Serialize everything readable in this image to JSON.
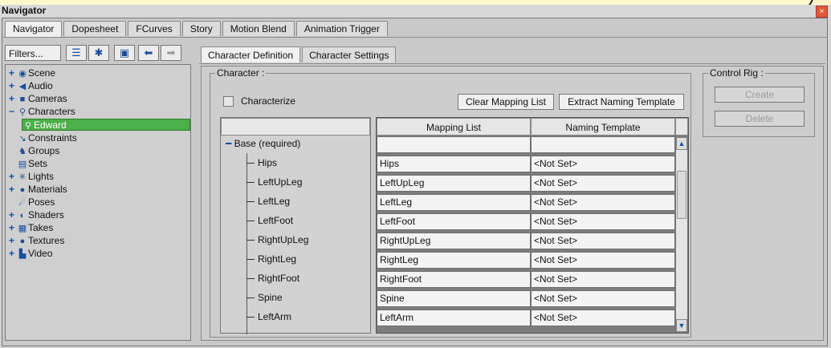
{
  "window": {
    "title": "Navigator",
    "close_glyph": "×"
  },
  "tabs": [
    "Navigator",
    "Dopesheet",
    "FCurves",
    "Story",
    "Motion Blend",
    "Animation Trigger"
  ],
  "left_toolbar": {
    "filters_label": "Filters...",
    "icons": [
      "list-icon",
      "pin-icon",
      "lock-icon",
      "back-arrow-icon",
      "forward-arrow-icon"
    ]
  },
  "tree": [
    {
      "label": "Scene",
      "icon": "scene-icon",
      "expand": "+"
    },
    {
      "label": "Audio",
      "icon": "audio-icon",
      "expand": "+"
    },
    {
      "label": "Cameras",
      "icon": "camera-icon",
      "expand": "+"
    },
    {
      "label": "Characters",
      "icon": "character-icon",
      "expand": "−"
    },
    {
      "label": "Edward",
      "icon": "character-icon",
      "expand": "",
      "selected": true
    },
    {
      "label": "Constraints",
      "icon": "constraint-icon",
      "expand": ""
    },
    {
      "label": "Groups",
      "icon": "groups-icon",
      "expand": ""
    },
    {
      "label": "Sets",
      "icon": "sets-icon",
      "expand": ""
    },
    {
      "label": "Lights",
      "icon": "light-icon",
      "expand": "+"
    },
    {
      "label": "Materials",
      "icon": "material-icon",
      "expand": "+"
    },
    {
      "label": "Poses",
      "icon": "pose-icon",
      "expand": ""
    },
    {
      "label": "Shaders",
      "icon": "shader-icon",
      "expand": "+"
    },
    {
      "label": "Takes",
      "icon": "takes-icon",
      "expand": "+"
    },
    {
      "label": "Textures",
      "icon": "texture-icon",
      "expand": "+"
    },
    {
      "label": "Video",
      "icon": "video-icon",
      "expand": "+"
    }
  ],
  "subtabs": [
    "Character Definition",
    "Character Settings"
  ],
  "character_group": {
    "label": "Character :",
    "characterize_label": "Characterize",
    "clear_button": "Clear Mapping List",
    "extract_button": "Extract Naming Template"
  },
  "control_rig": {
    "label": "Control Rig :",
    "create": "Create",
    "delete": "Delete"
  },
  "mapping": {
    "col_mapping": "Mapping List",
    "col_naming": "Naming Template",
    "base_label": "Base (required)",
    "rows": [
      {
        "bone": "Hips",
        "mapping": "Hips",
        "naming": "<Not Set>"
      },
      {
        "bone": "LeftUpLeg",
        "mapping": "LeftUpLeg",
        "naming": "<Not Set>"
      },
      {
        "bone": "LeftLeg",
        "mapping": "LeftLeg",
        "naming": "<Not Set>"
      },
      {
        "bone": "LeftFoot",
        "mapping": "LeftFoot",
        "naming": "<Not Set>"
      },
      {
        "bone": "RightUpLeg",
        "mapping": "RightUpLeg",
        "naming": "<Not Set>"
      },
      {
        "bone": "RightLeg",
        "mapping": "RightLeg",
        "naming": "<Not Set>"
      },
      {
        "bone": "RightFoot",
        "mapping": "RightFoot",
        "naming": "<Not Set>"
      },
      {
        "bone": "Spine",
        "mapping": "Spine",
        "naming": "<Not Set>"
      },
      {
        "bone": "LeftArm",
        "mapping": "LeftArm",
        "naming": "<Not Set>"
      }
    ]
  },
  "colors": {
    "selection": "#4caf4a",
    "icon_blue": "#1a4e9a",
    "close_red": "#e05a3a"
  }
}
